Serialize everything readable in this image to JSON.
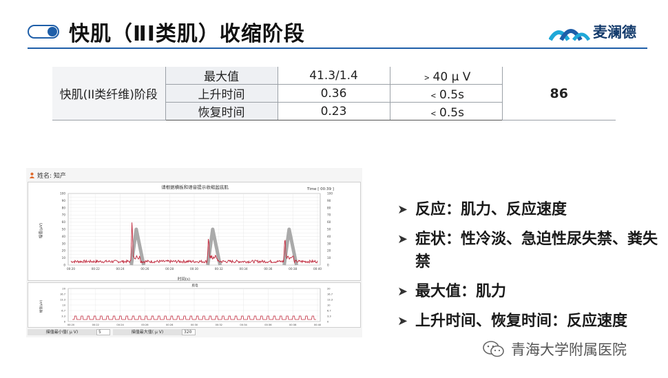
{
  "header": {
    "title": "快肌（ⅡI类肌）收缩阶段",
    "brand_name": "麦澜德",
    "icons": [
      "toggle-icon",
      "logo-waves-icon"
    ],
    "accent_color": "#1e5ea8",
    "brand_color": "#123a6b"
  },
  "table": {
    "stage_label": "快肌(ⅠI类纤维)阶段",
    "rows": [
      {
        "label": "最大值",
        "value": "41.3/1.4",
        "norm": "﹥40 μ V"
      },
      {
        "label": "上升时间",
        "value": "0.36",
        "norm": "﹤0.5s"
      },
      {
        "label": "恢复时间",
        "value": "0.23",
        "norm": "﹤0.5s"
      }
    ],
    "score": "86"
  },
  "device": {
    "user_label": "姓名: 知产",
    "chart_title": "请根据横板和语音提示收缩盆底肌",
    "time_label": "Time [ 00:39 ]",
    "y_label": "幅值(μV)",
    "x_label": "时间(s)",
    "bottom_title": "肌电",
    "bottom_y_label": "幅值(μV)",
    "input1_label": "描值最小值( μ V)",
    "input1_value": "5",
    "input2_label": "描值最大值( μ V)",
    "input2_value": "320",
    "icons": [
      "person-icon"
    ],
    "chart_data": {
      "type": "line",
      "x": [
        "00:20",
        "00:22",
        "00:24",
        "00:26",
        "00:28",
        "00:30",
        "00:32",
        "00:34",
        "00:36",
        "00:38",
        "00:40"
      ],
      "yticks": [
        0,
        5,
        10,
        15,
        20,
        25,
        30,
        35,
        40,
        45,
        50,
        55,
        60,
        65,
        70,
        75,
        80,
        85,
        90,
        95,
        100
      ],
      "ylim": [
        0,
        100
      ],
      "series": [
        {
          "color": "#c0263a",
          "peaks": [
            59,
            38,
            38
          ]
        },
        {
          "color": "#aaaaaa",
          "peaks": [
            50,
            50,
            50
          ]
        }
      ],
      "bottom_yticks": [
        "20",
        "16.7",
        "13.3",
        "10",
        "6.7",
        "3.3",
        "0"
      ]
    }
  },
  "bullets": [
    "反应：肌力、反应速度",
    "症状：性冷淡、急迫性尿失禁、粪失禁",
    "最大值：肌力",
    "上升时间、恢复时间：反应速度"
  ],
  "watermark": {
    "text": "青海大学附属医院",
    "icon": "wechat-icon"
  }
}
